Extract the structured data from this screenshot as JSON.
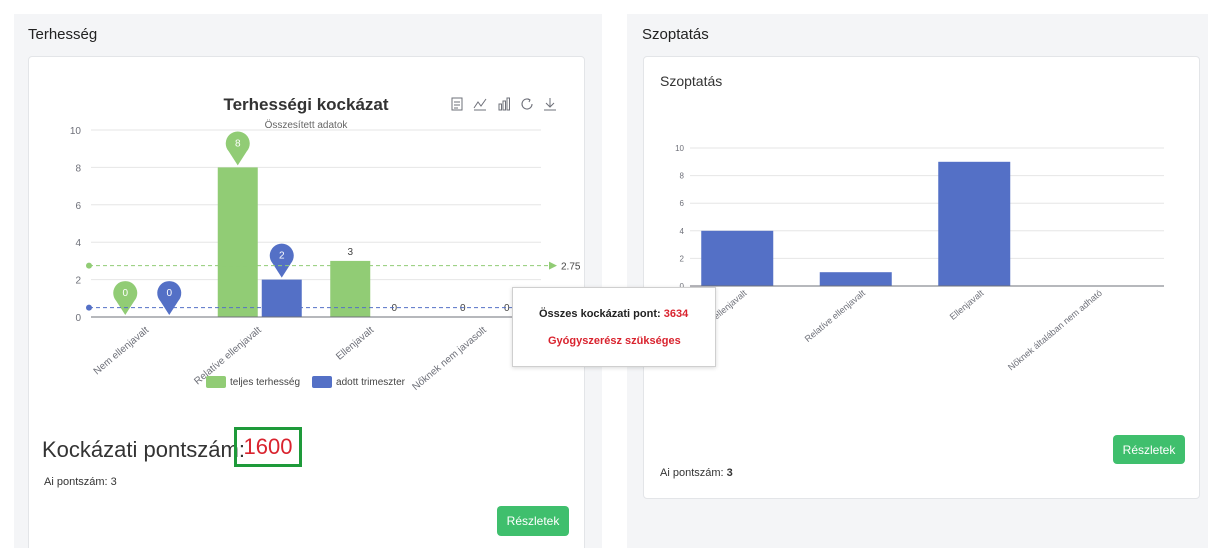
{
  "pregnancy": {
    "panel_title": "Terhesség",
    "chart": {
      "title": "Terhességi kockázat",
      "subtitle": "Összesített adatok",
      "toolbar_icons": [
        "data-view-icon",
        "line-chart-icon",
        "bar-chart-icon",
        "refresh-icon",
        "download-icon"
      ],
      "legend": [
        {
          "name": "teljes terhesség",
          "color": "#91cc75"
        },
        {
          "name": "adott trimeszter",
          "color": "#5470c6"
        }
      ],
      "markline_value": "2.75"
    },
    "score_label": "Kockázati pontszám:",
    "score_value": "1600",
    "ai_score": "Ai pontszám: 3",
    "details_button": "Részletek"
  },
  "breastfeeding": {
    "panel_title": "Szoptatás",
    "card_title": "Szoptatás",
    "ai_score_label": "Ai pontszám:",
    "ai_score_value": "3",
    "details_button": "Részletek"
  },
  "tooltip": {
    "total_label": "Összes kockázati pont:",
    "total_value": "3634",
    "warning": "Gyógyszerész szükséges"
  },
  "colors": {
    "green": "#91cc75",
    "blue": "#5470c6",
    "red": "#d9232e",
    "button": "#3fbf6d"
  },
  "chart_data": [
    {
      "type": "bar",
      "title": "Terhességi kockázat",
      "subtitle": "Összesített adatok",
      "categories": [
        "Nem ellenjavalt",
        "Relatíve ellenjavalt",
        "Ellenjavalt",
        "Nőknek nem javasolt"
      ],
      "series": [
        {
          "name": "teljes terhesség",
          "values": [
            0,
            8,
            3,
            0
          ],
          "color": "#91cc75"
        },
        {
          "name": "adott trimeszter",
          "values": [
            0,
            2,
            0,
            0
          ],
          "color": "#5470c6"
        }
      ],
      "ylim": [
        0,
        10
      ],
      "yticks": [
        0,
        2,
        4,
        6,
        8,
        10
      ],
      "markline": {
        "value": 2.75,
        "label": "2.75"
      },
      "legend_position": "bottom",
      "grid": true
    },
    {
      "type": "bar",
      "title": "Szoptatás",
      "categories": [
        "Nem ellenjavalt",
        "Relatíve ellenjavalt",
        "Ellenjavalt",
        "Nőknek általában nem adható"
      ],
      "series": [
        {
          "values": [
            4,
            1,
            9,
            0
          ],
          "color": "#5470c6"
        }
      ],
      "ylim": [
        0,
        10
      ],
      "yticks": [
        0,
        2,
        4,
        6,
        8,
        10
      ],
      "grid": true
    }
  ]
}
